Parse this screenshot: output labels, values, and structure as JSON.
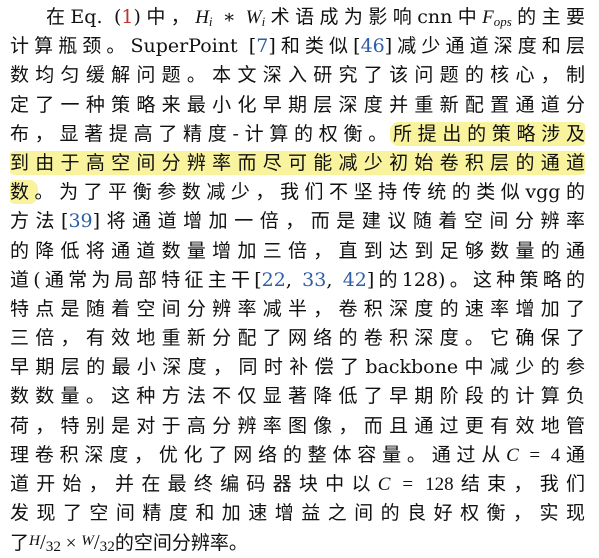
{
  "paragraph": {
    "l1": {
      "a": "在Eq. (",
      "eq_ref": "1",
      "b": ")中，",
      "h": "H",
      "i1": "i",
      "op": " ∗ ",
      "w": "W",
      "i2": "i",
      "c": "术语成为影响cnn中",
      "f": "F",
      "ops": "ops",
      "d": "的主要"
    },
    "l2": {
      "a": "计算瓶颈。SuperPoint [",
      "ref1": "7",
      "b": "]和类似[",
      "ref2": "46",
      "c": "]减少通道深度和层"
    },
    "l3": "数均匀缓解问题。本文深入研究了该问题的核心，制",
    "l4": "定了一种策略来最小化早期层深度并重新配置通道分",
    "l5": {
      "a": "布，显著提高了精度-计算的权衡。",
      "hl": "所提出的策略涉及"
    },
    "l6": {
      "hl": "到由于高空间分辨率而尽可能减少初始卷积层的通道"
    },
    "l7": {
      "hl": "数",
      "a": "。为了平衡参数减少，我们不坚持传统的类似vgg的"
    },
    "l8": {
      "a": "方法[",
      "ref": "39",
      "b": "]将通道增加一倍，而是建议随着空间分辨率"
    },
    "l9": "的降低将通道数量增加三倍，直到达到足够数量的通",
    "l10": {
      "a": "道(通常为局部特征主干[",
      "ref1": "22",
      "sep1": ", ",
      "ref2": "33",
      "sep2": ", ",
      "ref3": "42",
      "b": "]的128)。这种策略的"
    },
    "l11": "特点是随着空间分辨率减半，卷积深度的速率增加了",
    "l12": "三倍，有效地重新分配了网络的卷积深度。它确保了",
    "l13": "早期层的最小深度，同时补偿了backbone中减少的参",
    "l14": "数数量。这种方法不仅显著降低了早期阶段的计算负",
    "l15": "荷，特别是对于高分辨率图像，而且通过更有效地管",
    "l16": {
      "a": "理卷积深度，优化了网络的整体容量。通过从",
      "c": "C",
      "eq": " = ",
      "val": "4",
      "b": "通"
    },
    "l17": {
      "a": "道开始，并在最终编码器块中以",
      "c": "C",
      "eq": " = ",
      "val": "128",
      "b": "结束，我们"
    },
    "l18": "发现了空间精度和加速增益之间的良好权衡，实现",
    "l19": {
      "a": "了",
      "h": "H",
      "slash1": "/",
      "d1": "32",
      "times": " × ",
      "w": "W",
      "slash2": "/",
      "d2": "32",
      "b": "的空间分辨率。"
    }
  }
}
